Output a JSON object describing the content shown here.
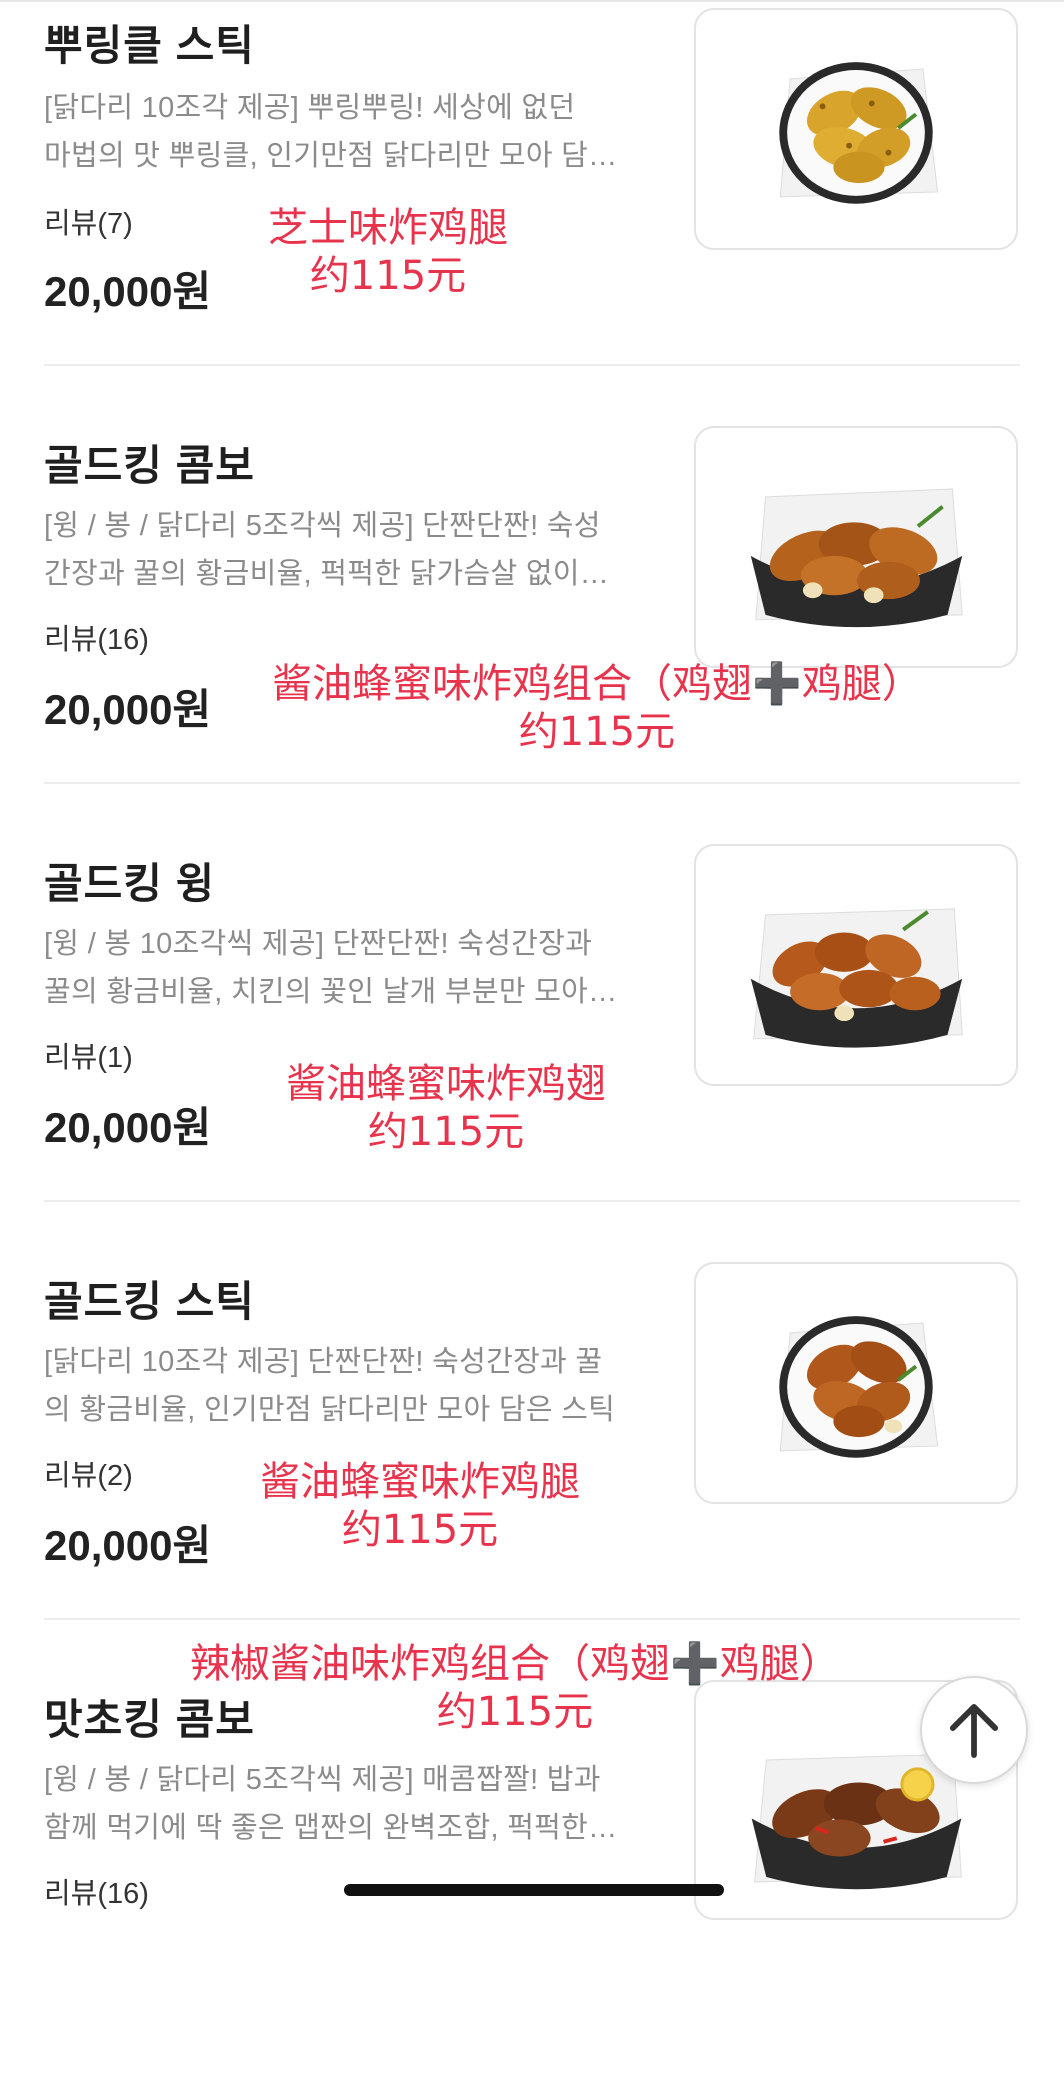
{
  "menu_items": [
    {
      "name": "뿌링클 스틱",
      "desc_line1": "[닭다리 10조각 제공] 뿌링뿌링! 세상에 없던",
      "desc_line2": "마법의 맛 뿌링클, 인기만점 닭다리만 모아 담…",
      "reviews": "리뷰(7)",
      "price": "20,000원",
      "annotation_line1": "芝士味炸鸡腿",
      "annotation_line2": "约115元",
      "image_icon": "fried-chicken-drumsticks-basket",
      "chicken_color": "#d9a42b"
    },
    {
      "name": "골드킹 콤보",
      "desc_line1": "[윙 / 봉 / 닭다리 5조각씩 제공] 단짠단짠! 숙성",
      "desc_line2": "간장과 꿀의 황금비율, 퍽퍽한 닭가슴살 없이…",
      "reviews": "리뷰(16)",
      "price": "20,000원",
      "annotation_line1": "酱油蜂蜜味炸鸡组合（鸡翅➕鸡腿）",
      "annotation_line2": "约115元",
      "image_icon": "fried-chicken-combo-basket",
      "chicken_color": "#b5621d"
    },
    {
      "name": "골드킹 윙",
      "desc_line1": "[윙 / 봉 10조각씩 제공] 단짠단짠! 숙성간장과",
      "desc_line2": "꿀의 황금비율, 치킨의 꽃인 날개 부분만 모아…",
      "reviews": "리뷰(1)",
      "price": "20,000원",
      "annotation_line1": "酱油蜂蜜味炸鸡翅",
      "annotation_line2": "约115元",
      "image_icon": "fried-chicken-wings-basket",
      "chicken_color": "#b55a1c"
    },
    {
      "name": "골드킹 스틱",
      "desc_line1": "[닭다리 10조각 제공] 단짠단짠! 숙성간장과 꿀",
      "desc_line2": "의 황금비율, 인기만점 닭다리만 모아 담은 스틱",
      "reviews": "리뷰(2)",
      "price": "20,000원",
      "annotation_line1": "酱油蜂蜜味炸鸡腿",
      "annotation_line2": "约115元",
      "image_icon": "fried-chicken-drumsticks-basket",
      "chicken_color": "#b0581b"
    },
    {
      "name": "맛초킹 콤보",
      "desc_line1": "[윙 / 봉 / 닭다리 5조각씩 제공] 매콤짭짤! 밥과",
      "desc_line2": "함께 먹기에 딱 좋은 맵짠의 완벽조합, 퍽퍽한…",
      "reviews": "리뷰(16)",
      "price": "",
      "annotation_line1": "辣椒酱油味炸鸡组合（鸡翅➕鸡腿）",
      "annotation_line2": "约115元",
      "image_icon": "spicy-fried-chicken-combo-basket",
      "chicken_color": "#7a3a18"
    }
  ],
  "scroll_top_button": {
    "icon": "arrow-up-icon"
  }
}
